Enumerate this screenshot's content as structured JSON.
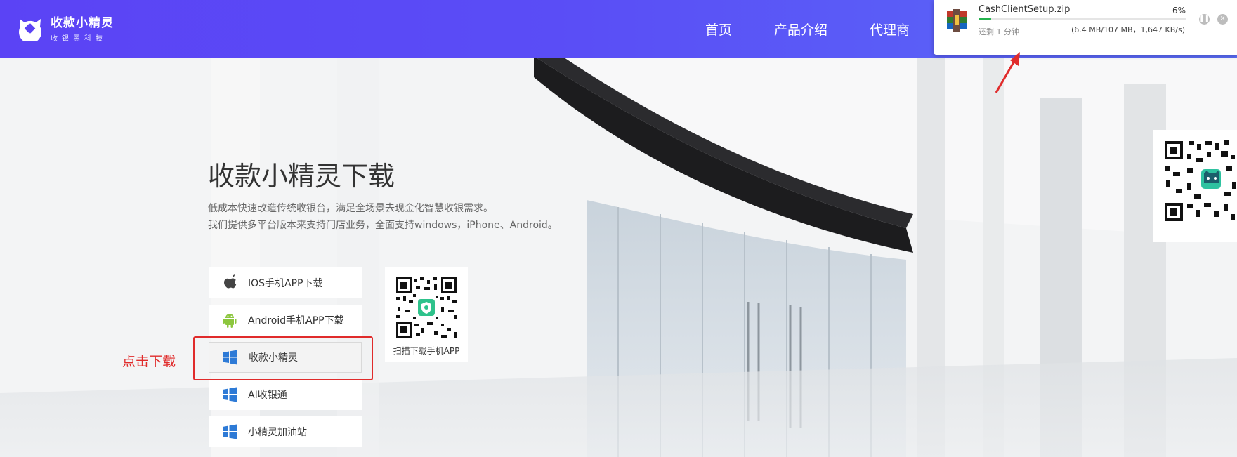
{
  "brand": {
    "name": "收款小精灵",
    "subtitle": "收银黑科技"
  },
  "nav": {
    "items": [
      "首页",
      "产品介绍",
      "代理商"
    ]
  },
  "download": {
    "filename": "CashClientSetup.zip",
    "percent_text": "6%",
    "progress": 0.06,
    "eta": "还剩 1 分钟",
    "speed": "(6.4 MB/107 MB，1,647 KB/s)",
    "pause_icon": "pause-icon",
    "close_icon": "close-icon"
  },
  "main": {
    "title": "收款小精灵下载",
    "desc_line1": "低成本快速改造传统收银台，满足全场景去现金化智慧收银需求。",
    "desc_line2": "我们提供多平台版本来支持门店业务，全面支持windows，iPhone、Android。",
    "buttons": [
      {
        "label": "IOS手机APP下载",
        "icon": "apple-icon"
      },
      {
        "label": "Android手机APP下载",
        "icon": "android-icon"
      },
      {
        "label": "收款小精灵",
        "icon": "windows-icon"
      },
      {
        "label": "AI收银通",
        "icon": "windows-icon"
      },
      {
        "label": "小精灵加油站",
        "icon": "windows-icon"
      }
    ],
    "qr_caption": "扫描下载手机APP",
    "annotation": "点击下载"
  },
  "colors": {
    "header_start": "#5b43f5",
    "header_end": "#5a6cf8",
    "annotation_red": "#e02b2b",
    "progress_green": "#22b24c",
    "android_green": "#8cc63e",
    "windows_blue": "#2d7ad6"
  }
}
